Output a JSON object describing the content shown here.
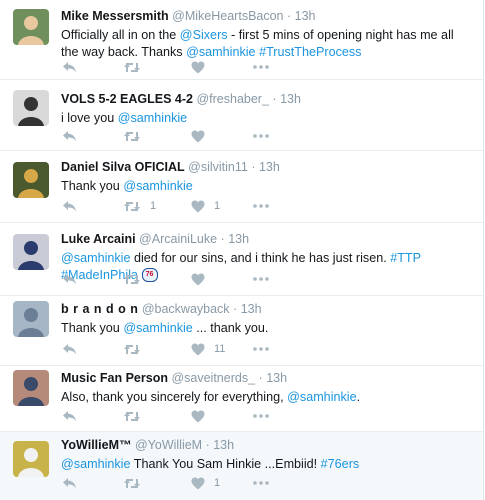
{
  "tweets": [
    {
      "name": "Mike Messersmith",
      "handle": "@MikeHeartsBacon",
      "time": "13h",
      "segments": [
        {
          "t": "Officially all in on the "
        },
        {
          "t": "@Sixers",
          "link": true
        },
        {
          "t": " - first 5 mins of opening night has me all the way back.  Thanks "
        },
        {
          "t": "@samhinkie",
          "link": true
        },
        {
          "t": " "
        },
        {
          "t": "#TrustTheProcess",
          "link": true
        }
      ],
      "retweets": "",
      "likes": "",
      "highlight": false,
      "avatar": {
        "bg": "#6f8f5c",
        "fg": "#e9c89f"
      }
    },
    {
      "name": "VOLS 5-2 EAGLES 4-2",
      "handle": "@freshaber_",
      "time": "13h",
      "segments": [
        {
          "t": "i love you "
        },
        {
          "t": "@samhinkie",
          "link": true
        }
      ],
      "retweets": "",
      "likes": "",
      "highlight": false,
      "avatar": {
        "bg": "#d9d9d9",
        "fg": "#333333"
      }
    },
    {
      "name": "Daniel Silva OFICIAL",
      "handle": "@silvitin11",
      "time": "13h",
      "segments": [
        {
          "t": "Thank you  "
        },
        {
          "t": "@samhinkie",
          "link": true
        }
      ],
      "retweets": "1",
      "likes": "1",
      "highlight": false,
      "avatar": {
        "bg": "#4a5a2e",
        "fg": "#d8a848"
      }
    },
    {
      "name": "Luke Arcaini",
      "handle": "@ArcainiLuke",
      "time": "13h",
      "segments": [
        {
          "t": "@samhinkie",
          "link": true
        },
        {
          "t": " died for our sins, and i think he has just risen. "
        },
        {
          "t": "#TTP",
          "link": true
        },
        {
          "t": " "
        },
        {
          "t": "#MadeInPhila",
          "link": true
        },
        {
          "t": " "
        },
        {
          "t": "76",
          "emoji": true
        }
      ],
      "retweets": "",
      "likes": "",
      "highlight": false,
      "avatar": {
        "bg": "#c9ccd6",
        "fg": "#2a3b6e"
      }
    },
    {
      "name": "b r a n d o n",
      "handle": "@backwayback",
      "time": "13h",
      "segments": [
        {
          "t": "Thank you "
        },
        {
          "t": "@samhinkie",
          "link": true
        },
        {
          "t": " ... thank you."
        }
      ],
      "retweets": "",
      "likes": "11",
      "highlight": false,
      "avatar": {
        "bg": "#a7b6c6",
        "fg": "#6a7f95"
      }
    },
    {
      "name": "Music Fan Person",
      "handle": "@saveitnerds_",
      "time": "13h",
      "segments": [
        {
          "t": "Also, thank you sincerely for everything, "
        },
        {
          "t": "@samhinkie",
          "link": true
        },
        {
          "t": "."
        }
      ],
      "retweets": "",
      "likes": "",
      "highlight": false,
      "avatar": {
        "bg": "#b58a7a",
        "fg": "#3a4a6a"
      }
    },
    {
      "name": "YoWillieM™",
      "handle": "@YoWillieM",
      "time": "13h",
      "segments": [
        {
          "t": "@samhinkie",
          "link": true
        },
        {
          "t": " Thank You Sam Hinkie ...Embiid! "
        },
        {
          "t": "#76ers",
          "link": true
        }
      ],
      "retweets": "",
      "likes": "1",
      "highlight": true,
      "avatar": {
        "bg": "#c8b24a",
        "fg": "#f2f2f2"
      }
    }
  ],
  "icons": {
    "reply": "reply-icon",
    "retweet": "retweet-icon",
    "like": "heart-icon",
    "more": "more-icon"
  },
  "colors": {
    "link": "#1b95e0",
    "muted": "#8899a6",
    "icon": "#aab8c2",
    "highlight_bg": "#f5f8fa"
  }
}
